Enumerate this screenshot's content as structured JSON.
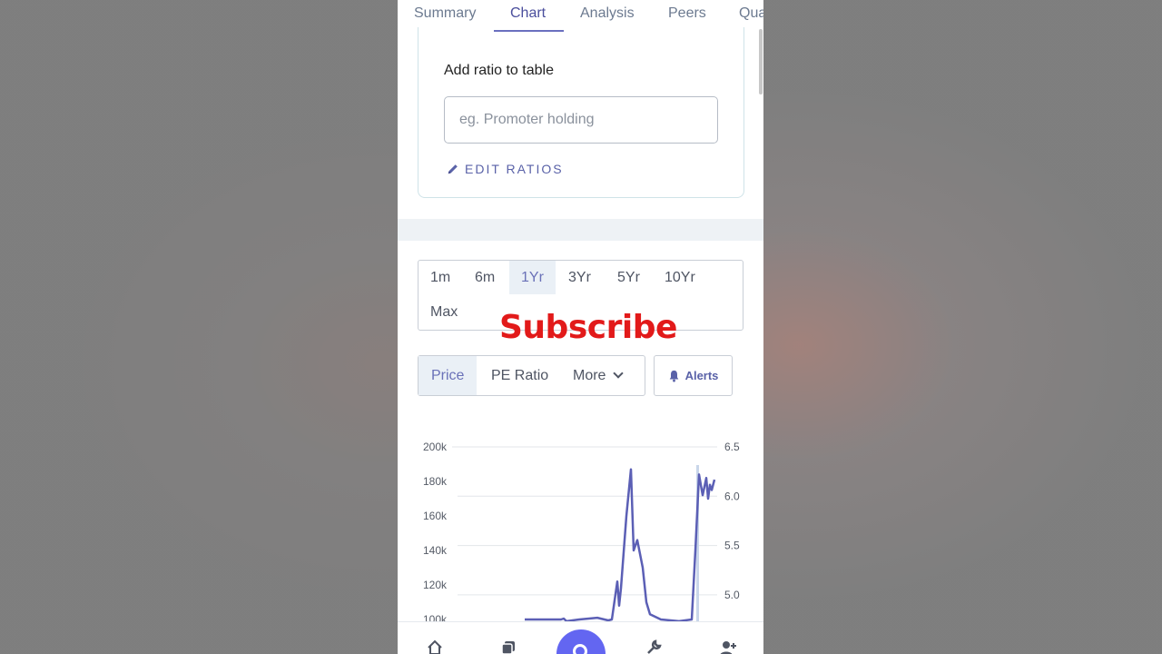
{
  "tabs": [
    {
      "label": "Summary"
    },
    {
      "label": "Chart"
    },
    {
      "label": "Analysis"
    },
    {
      "label": "Peers"
    },
    {
      "label": "Qua"
    }
  ],
  "active_tab": "Chart",
  "ratio_card": {
    "title": "Add ratio to table",
    "input_placeholder": "eg. Promoter holding",
    "edit_label": "EDIT RATIOS"
  },
  "periods": [
    "1m",
    "6m",
    "1Yr",
    "3Yr",
    "5Yr",
    "10Yr",
    "Max"
  ],
  "active_period": "1Yr",
  "chart_types": {
    "price": "Price",
    "pe": "PE Ratio",
    "more": "More"
  },
  "active_chart_type": "Price",
  "alerts_label": "Alerts",
  "overlay_text": "Subscribe",
  "colors": {
    "accent": "#6366f1",
    "line": "#5b5fb5",
    "overlay": "#e21a1a"
  },
  "chart_data": {
    "type": "line",
    "y_left_ticks": [
      "200k",
      "180k",
      "160k",
      "140k",
      "120k",
      "100k"
    ],
    "y_right_ticks": [
      "6.5",
      "6.0",
      "5.5",
      "5.0"
    ],
    "ylim_left": [
      100000,
      200000
    ],
    "ylim_right": [
      4.75,
      6.5
    ],
    "series": [
      {
        "values": [
          100000,
          100000,
          100000,
          100500,
          99000,
          100000,
          101000,
          99500,
          100000,
          122000,
          108000,
          118000,
          160000,
          187000,
          140000,
          146000,
          130000,
          110000,
          103000,
          100000,
          99000,
          100000,
          140000,
          184000,
          172000,
          182000,
          170000,
          178000,
          175000,
          181000
        ]
      }
    ],
    "grid": true
  }
}
